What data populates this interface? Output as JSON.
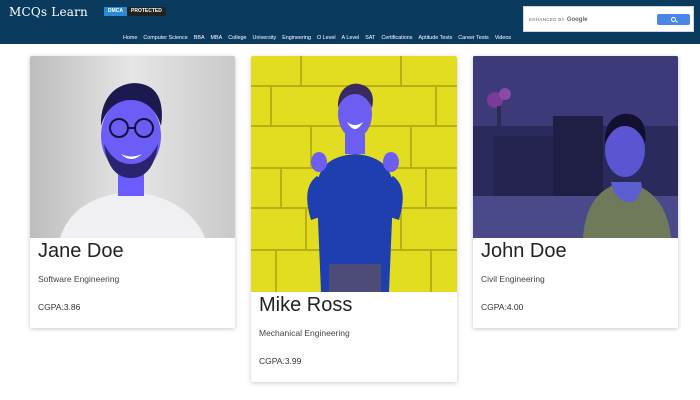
{
  "header": {
    "logo": "MCQs Learn",
    "badge_left": "DMCA",
    "badge_right": "PROTECTED",
    "search": {
      "enhanced_by": "ENHANCED BY",
      "brand": "Google"
    },
    "nav": [
      "Home",
      "Computer Science",
      "BBA",
      "MBA",
      "College",
      "University",
      "Engineering",
      "O Level",
      "A Level",
      "SAT",
      "Certifications",
      "Aptitude Tests",
      "Career Tests",
      "Videos"
    ]
  },
  "cards": [
    {
      "name": "Jane Doe",
      "department": "Software Engineering",
      "cgpa_label": "CGPA:",
      "cgpa": "3.86"
    },
    {
      "name": "Mike Ross",
      "department": "Mechanical Engineering",
      "cgpa_label": "CGPA:",
      "cgpa": "3.99"
    },
    {
      "name": "John Doe",
      "department": "Civil Engineering",
      "cgpa_label": "CGPA:",
      "cgpa": "4.00"
    }
  ],
  "colors": {
    "header_bg": "#0b3a5f",
    "photo_tint": "#6a5cff",
    "wall_yellow": "#e6df1e"
  },
  "icons": {
    "search_button": "search-icon",
    "photo_1": "person-photo",
    "photo_2": "person-photo",
    "photo_3": "person-photo"
  }
}
